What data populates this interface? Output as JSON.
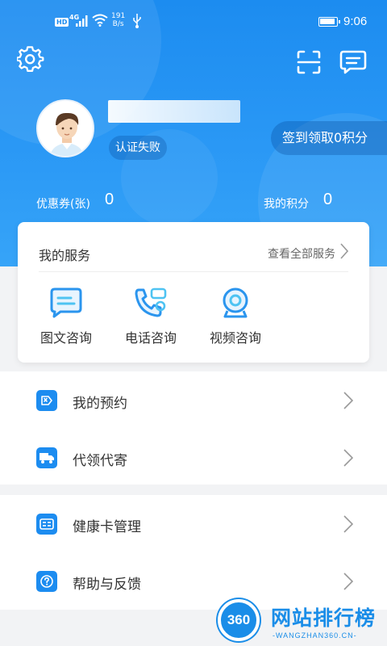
{
  "status_bar": {
    "network_badge": "HD",
    "network_type": "4G",
    "speed_value": "191",
    "speed_unit": "B/s",
    "time": "9:06"
  },
  "header": {
    "settings_icon": "gear-icon",
    "scan_icon": "scan-icon",
    "message_icon": "message-icon"
  },
  "profile": {
    "verify_status": "认证失败",
    "checkin_label": "签到领取0积分"
  },
  "stats": {
    "coupon_label": "优惠券(张)",
    "coupon_value": "0",
    "points_label": "我的积分",
    "points_value": "0"
  },
  "services": {
    "title": "我的服务",
    "view_all": "查看全部服务",
    "items": [
      {
        "label": "图文咨询",
        "icon": "chat-text-icon"
      },
      {
        "label": "电话咨询",
        "icon": "phone-chat-icon"
      },
      {
        "label": "视频咨询",
        "icon": "webcam-icon"
      }
    ]
  },
  "menu": {
    "group1": [
      {
        "label": "我的预约",
        "icon": "appointment-icon"
      },
      {
        "label": "代领代寄",
        "icon": "truck-icon"
      }
    ],
    "group2": [
      {
        "label": "健康卡管理",
        "icon": "card-icon"
      },
      {
        "label": "帮助与反馈",
        "icon": "help-icon"
      }
    ]
  },
  "watermark": {
    "logo_text": "360",
    "title": "网站排行榜",
    "subtitle": "-WANGZHAN360.CN-"
  },
  "colors": {
    "primary": "#1c8cf0",
    "hero_bottom": "#36a4f8",
    "background": "#f2f3f5"
  }
}
